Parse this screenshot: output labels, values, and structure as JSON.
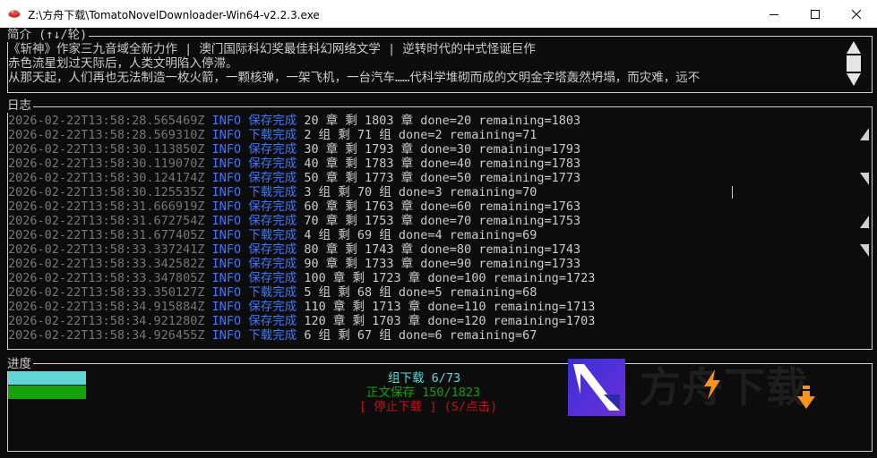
{
  "window": {
    "title": "Z:\\方舟下载\\TomatoNovelDownloader-Win64-v2.2.3.exe",
    "controls": [
      "minimize",
      "maximize",
      "close"
    ]
  },
  "intro": {
    "heading": "简介 (↑↓/轮)",
    "lines": [
      "《斩神》作家三九音域全新力作 | 澳门国际科幻奖最佳科幻网络文学 | 逆转时代的中式怪诞巨作",
      "赤色流星划过天际后，人类文明陷入停滞。",
      "从那天起，人们再也无法制造一枚火箭，一颗核弹，一架飞机，一台汽车……代科学堆砌而成的文明金字塔轰然坍塌，而灾难，远不"
    ]
  },
  "log": {
    "heading": "日志",
    "entries": [
      {
        "ts": "2026-02-22T13:58:28.565469Z",
        "level": "INFO",
        "action": "保存完成",
        "msg": "20 章 剩 1803 章 done=20 remaining=1803"
      },
      {
        "ts": "2026-02-22T13:58:28.569310Z",
        "level": "INFO",
        "action": "下载完成",
        "msg": "2 组 剩 71 组 done=2 remaining=71"
      },
      {
        "ts": "2026-02-22T13:58:30.113850Z",
        "level": "INFO",
        "action": "保存完成",
        "msg": "30 章 剩 1793 章 done=30 remaining=1793"
      },
      {
        "ts": "2026-02-22T13:58:30.119070Z",
        "level": "INFO",
        "action": "保存完成",
        "msg": "40 章 剩 1783 章 done=40 remaining=1783"
      },
      {
        "ts": "2026-02-22T13:58:30.124174Z",
        "level": "INFO",
        "action": "保存完成",
        "msg": "50 章 剩 1773 章 done=50 remaining=1773"
      },
      {
        "ts": "2026-02-22T13:58:30.125535Z",
        "level": "INFO",
        "action": "下载完成",
        "msg": "3 组 剩 70 组 done=3 remaining=70"
      },
      {
        "ts": "2026-02-22T13:58:31.666919Z",
        "level": "INFO",
        "action": "保存完成",
        "msg": "60 章 剩 1763 章 done=60 remaining=1763"
      },
      {
        "ts": "2026-02-22T13:58:31.672754Z",
        "level": "INFO",
        "action": "保存完成",
        "msg": "70 章 剩 1753 章 done=70 remaining=1753"
      },
      {
        "ts": "2026-02-22T13:58:31.677405Z",
        "level": "INFO",
        "action": "下载完成",
        "msg": "4 组 剩 69 组 done=4 remaining=69"
      },
      {
        "ts": "2026-02-22T13:58:33.337241Z",
        "level": "INFO",
        "action": "保存完成",
        "msg": "80 章 剩 1743 章 done=80 remaining=1743"
      },
      {
        "ts": "2026-02-22T13:58:33.342582Z",
        "level": "INFO",
        "action": "保存完成",
        "msg": "90 章 剩 1733 章 done=90 remaining=1733"
      },
      {
        "ts": "2026-02-22T13:58:33.347805Z",
        "level": "INFO",
        "action": "保存完成",
        "msg": "100 章 剩 1723 章 done=100 remaining=1723"
      },
      {
        "ts": "2026-02-22T13:58:33.350127Z",
        "level": "INFO",
        "action": "下载完成",
        "msg": "5 组 剩 68 组 done=5 remaining=68"
      },
      {
        "ts": "2026-02-22T13:58:34.915884Z",
        "level": "INFO",
        "action": "保存完成",
        "msg": "110 章 剩 1713 章 done=110 remaining=1713"
      },
      {
        "ts": "2026-02-22T13:58:34.921280Z",
        "level": "INFO",
        "action": "保存完成",
        "msg": "120 章 剩 1703 章 done=120 remaining=1703"
      },
      {
        "ts": "2026-02-22T13:58:34.926455Z",
        "level": "INFO",
        "action": "下载完成",
        "msg": "6 组 剩 67 组 done=6 remaining=67"
      }
    ]
  },
  "progress": {
    "heading": "进度",
    "group_label": "组下载 6/73",
    "save_label": "正文保存 150/1823",
    "stop_label": "[ 停止下载 ] (S/点击)",
    "group_fraction": 0.082,
    "save_fraction": 0.082
  },
  "logo": {
    "text": "方舟下载"
  },
  "colors": {
    "console_bg": "#0c0c0c",
    "info": "#3b78ff",
    "timestamp": "#767676",
    "group_bar": "#61d6d6",
    "save_bar": "#13a10e",
    "stop": "#c50f1f",
    "logo_orange": "#f7941d"
  }
}
